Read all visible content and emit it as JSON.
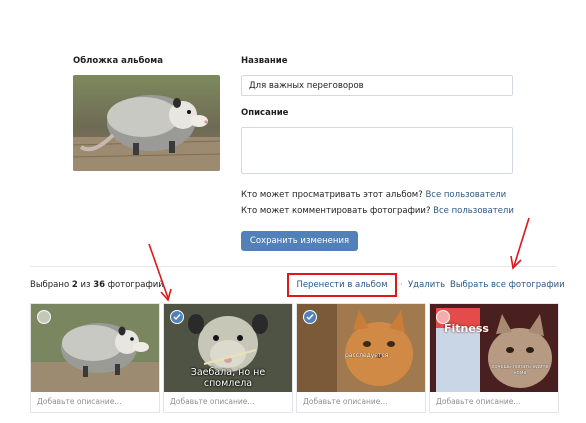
{
  "cover": {
    "label": "Обложка альбома",
    "image_icon": "opossum-photo"
  },
  "form": {
    "title_label": "Название",
    "title_value": "Для важных переговоров",
    "description_label": "Описание",
    "description_value": "",
    "privacy_view_question": "Кто может просматривать этот альбом?",
    "privacy_view_value": "Все пользователи",
    "privacy_comment_question": "Кто может комментировать фотографии?",
    "privacy_comment_value": "Все пользователи",
    "save_label": "Сохранить изменения"
  },
  "selection": {
    "prefix": "Выбрано",
    "selected_count": "2",
    "middle": "из",
    "total_count": "36",
    "suffix": "фотографий",
    "move_label": "Перенести в альбом",
    "delete_label": "Удалить",
    "select_all_label": "Выбрать все фотографии",
    "separator": "·"
  },
  "photos": [
    {
      "selected": false,
      "caption": "Добавьте описание...",
      "icon": "opossum-photo"
    },
    {
      "selected": true,
      "caption": "Добавьте описание...",
      "icon": "opossum-meme-photo",
      "overlay": "Заебала, но не спомлела"
    },
    {
      "selected": true,
      "caption": "Добавьте описание...",
      "icon": "cat-photo",
      "overlay": "расследуется"
    },
    {
      "selected": false,
      "caption": "Добавьте описание...",
      "icon": "cat-fitness-photo",
      "brand": "Fitness",
      "overlay": "хочешь лопать едите нома"
    }
  ],
  "colors": {
    "link": "#2a5885",
    "button": "#5181b8",
    "highlight_box": "#e0161b",
    "arrow": "#e0161b"
  }
}
